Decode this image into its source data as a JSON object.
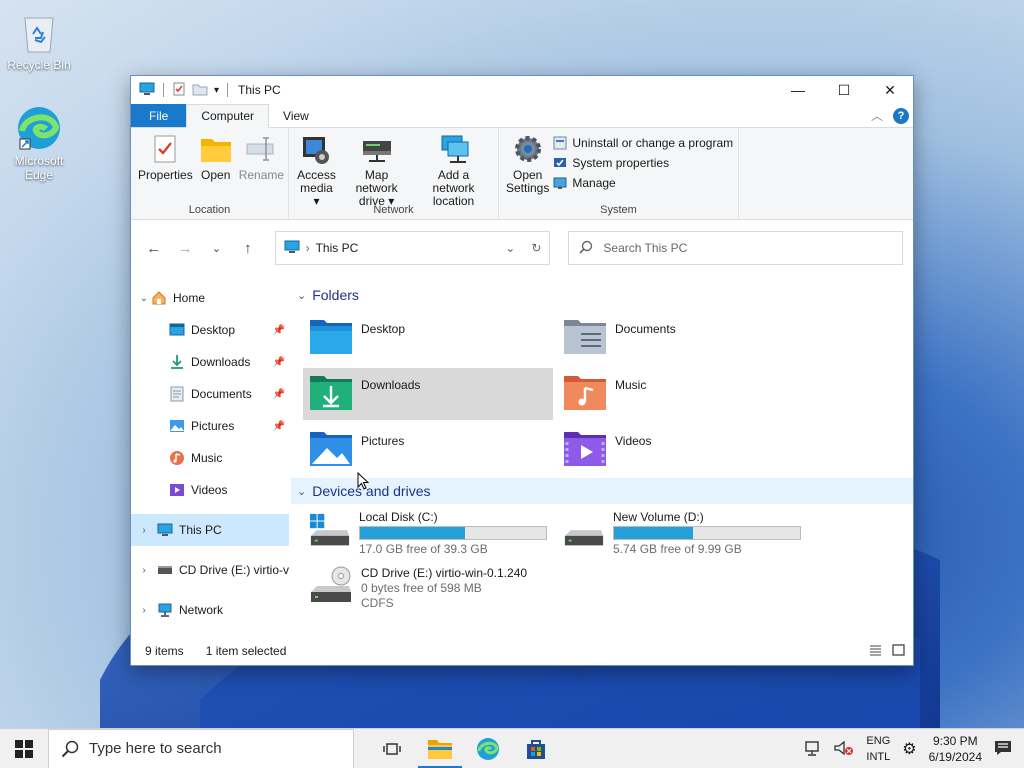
{
  "desktop": {
    "icons": [
      {
        "label": "Recycle Bin",
        "icon": "recycle-bin-icon"
      },
      {
        "label": "Microsoft Edge",
        "icon": "edge-icon"
      }
    ]
  },
  "window": {
    "title": "This PC",
    "controls": {
      "minimize": "—",
      "maximize": "☐",
      "close": "✕"
    },
    "tabs": [
      {
        "label": "File"
      },
      {
        "label": "Computer"
      },
      {
        "label": "View"
      }
    ],
    "ribbon": {
      "location": {
        "label": "Location",
        "properties": "Properties",
        "open": "Open",
        "rename": "Rename"
      },
      "network": {
        "label": "Network",
        "access_media_1": "Access",
        "access_media_2": "media ▾",
        "map_drive_1": "Map network",
        "map_drive_2": "drive ▾",
        "add_location_1": "Add a network",
        "add_location_2": "location"
      },
      "system": {
        "label": "System",
        "open_settings_1": "Open",
        "open_settings_2": "Settings",
        "uninstall": "Uninstall or change a program",
        "system_properties": "System properties",
        "manage": "Manage"
      }
    },
    "address": {
      "crumb": "This PC",
      "search_placeholder": "Search This PC"
    },
    "nav": {
      "home": "Home",
      "desktop": "Desktop",
      "downloads": "Downloads",
      "documents": "Documents",
      "pictures": "Pictures",
      "music": "Music",
      "videos": "Videos",
      "this_pc": "This PC",
      "cd_drive": "CD Drive (E:) virtio-v",
      "network": "Network"
    },
    "folders_heading": "Folders",
    "folders": {
      "desktop": "Desktop",
      "documents": "Documents",
      "downloads": "Downloads",
      "music": "Music",
      "pictures": "Pictures",
      "videos": "Videos"
    },
    "drives_heading": "Devices and drives",
    "drives": {
      "c": {
        "name": "Local Disk (C:)",
        "free": "17.0 GB free of 39.3 GB",
        "used_fraction": 0.567
      },
      "d": {
        "name": "New Volume (D:)",
        "free": "5.74 GB free of 9.99 GB",
        "used_fraction": 0.425
      },
      "e": {
        "name": "CD Drive (E:) virtio-win-0.1.240",
        "free": "0 bytes free of 598 MB",
        "fs": "CDFS"
      }
    },
    "status": {
      "items": "9 items",
      "selected": "1 item selected"
    }
  },
  "taskbar": {
    "search_placeholder": "Type here to search",
    "lang_1": "ENG",
    "lang_2": "INTL",
    "time": "9:30 PM",
    "date": "6/19/2024"
  },
  "colors": {
    "accent": "#1979ca",
    "selection": "#cce8ff",
    "bar_fill": "#26a0da"
  }
}
